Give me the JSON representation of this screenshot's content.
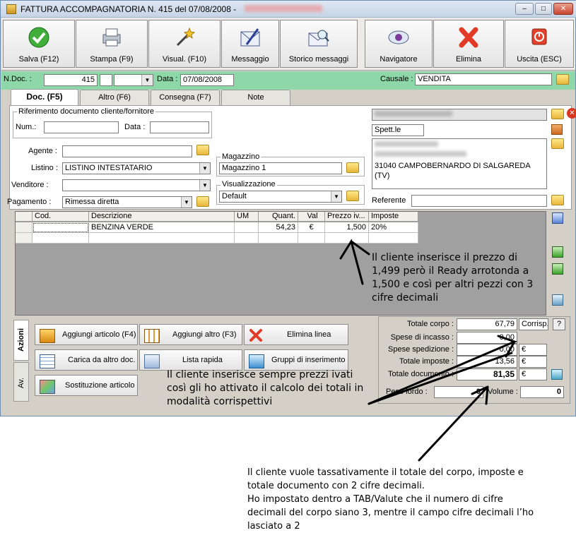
{
  "window": {
    "title": "FATTURA ACCOMPAGNATORIA N. 415  del 07/08/2008 -",
    "controls": [
      "–",
      "□",
      "✕"
    ]
  },
  "toolbar": {
    "buttons": [
      {
        "label": "Salva (F12)",
        "icon": "check-icon"
      },
      {
        "label": "Stampa (F9)",
        "icon": "printer-icon"
      },
      {
        "label": "Visual. (F10)",
        "icon": "magic-wand-icon"
      },
      {
        "label": "Messaggio",
        "icon": "pencil-envelope-icon"
      },
      {
        "label": "Storico messaggi",
        "icon": "envelope-search-icon"
      },
      {
        "label": "Navigatore",
        "icon": "eye-icon"
      },
      {
        "label": "Elimina",
        "icon": "delete-x-icon"
      },
      {
        "label": "Uscita (ESC)",
        "icon": "power-icon"
      }
    ]
  },
  "header": {
    "ndoc_label": "N.Doc. :",
    "ndoc_value": "415",
    "data_label": "Data :",
    "data_value": "07/08/2008",
    "causale_label": "Causale :",
    "causale_value": "VENDITA"
  },
  "tabs": [
    "Doc. (F5)",
    "Altro (F6)",
    "Consegna (F7)",
    "Note"
  ],
  "doc": {
    "rif_label": "Riferimento documento cliente/fornitore",
    "num_label": "Num.:",
    "num_value": "",
    "data_label": "Data :",
    "data_value": "",
    "agente_label": "Agente :",
    "agente_value": "",
    "listino_label": "Listino :",
    "listino_value": "LISTINO INTESTATARIO",
    "venditore_label": "Venditore :",
    "venditore_value": "",
    "pagamento_label": "Pagamento :",
    "pagamento_value": "Rimessa diretta",
    "magazzino_label": "Magazzino",
    "magazzino_value": "Magazzino 1",
    "visualizzazione_label": "Visualizzazione",
    "visualizzazione_value": "Default",
    "spett_value": "Spett.le",
    "address_line": "31040 CAMPOBERNARDO DI SALGAREDA",
    "address_prov": "(TV)",
    "referente_label": "Referente",
    "referente_value": ""
  },
  "grid": {
    "headers": [
      "Cod.",
      "Descrizione",
      "UM",
      "Quant.",
      "Val",
      "Prezzo iv...",
      "Imposte"
    ],
    "rows": [
      [
        "",
        "BENZINA VERDE",
        "",
        "54,23",
        "€",
        "1,500",
        "20%"
      ],
      [
        "",
        "",
        "",
        "",
        "",
        "",
        ""
      ]
    ]
  },
  "actions": {
    "side_tabs": [
      "Azioni",
      "Av."
    ],
    "buttons": [
      {
        "label": "Aggiungi articolo (F4)",
        "icon": "add-box-icon"
      },
      {
        "label": "Aggiungi altro (F3)",
        "icon": "add-grid-icon"
      },
      {
        "label": "Elimina linea",
        "icon": "delete-x-icon"
      },
      {
        "label": "Carica da altro doc.",
        "icon": "load-doc-icon"
      },
      {
        "label": "Lista rapida",
        "icon": "quick-list-icon"
      },
      {
        "label": "Gruppi di inserimento",
        "icon": "group-insert-icon"
      },
      {
        "label": "Sostituzione articolo",
        "icon": "replace-item-icon"
      }
    ]
  },
  "totals": {
    "totale_corpo_label": "Totale corpo :",
    "totale_corpo_value": "67,79",
    "corrisp_label": "Corrisp.",
    "help_label": "?",
    "spese_incasso_label": "Spese di incasso :",
    "spese_incasso_value": "0,00",
    "spese_spedizione_label": "Spese spedizione :",
    "spese_spedizione_value": "0,00",
    "spese_spedizione_currency": "€",
    "totale_imposte_label": "Totale imposte :",
    "totale_imposte_value": "13,56",
    "totale_imposte_currency": "€",
    "totale_documento_label": "Totale documento :",
    "totale_documento_value": "81,35",
    "totale_documento_currency": "€",
    "peso_lordo_label": "Peso lordo :",
    "peso_lordo_value": "0",
    "volume_label": "Volume :",
    "volume_value": "0"
  },
  "annotations": {
    "note1": [
      "Il cliente inserisce il prezzo di",
      "1,499 però il Ready arrotonda a",
      "1,500 e così per altri pezzi con 3",
      "cifre decimali"
    ],
    "note2": [
      "Il cliente inserisce sempre prezzi ivati",
      "così gli ho attivato il calcolo dei totali in",
      "modalità corrispettivi"
    ],
    "note3": [
      "Il cliente vuole tassativamente il totale del corpo, imposte e",
      "totale documento con 2 cifre decimali.",
      "Ho impostato dentro a TAB/Valute che il numero di cifre",
      "decimali del corpo siano 3, mentre il campo cifre decimali l’ho",
      "lasciato a 2"
    ]
  }
}
